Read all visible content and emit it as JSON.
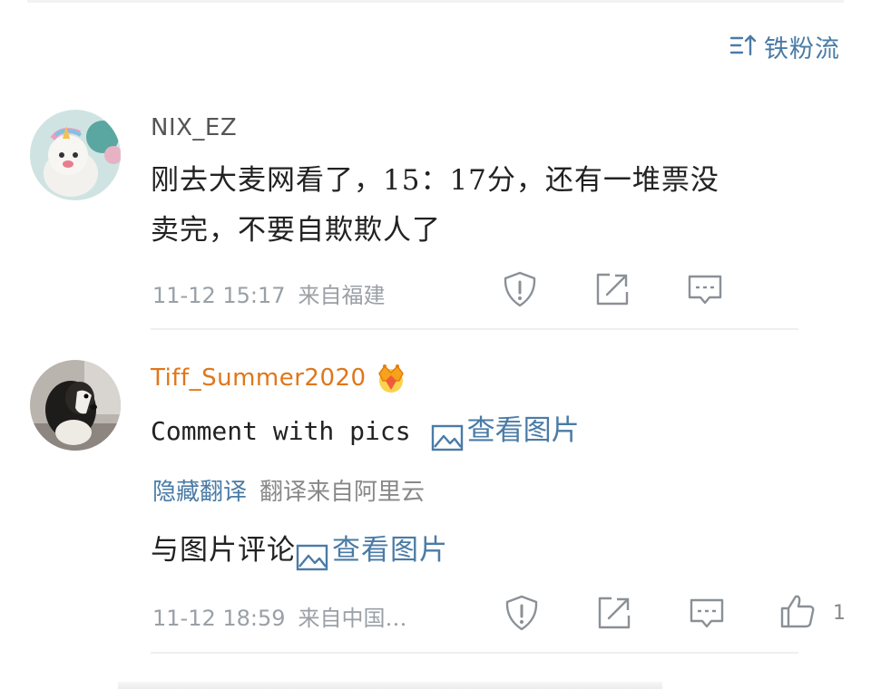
{
  "header": {
    "sort_label": "铁粉流",
    "sort_icon": "sort-icon"
  },
  "comments": [
    {
      "username": "NIX_EZ",
      "text_line1": "刚去大麦网看了，15：17分，还有一堆票没",
      "text_line2": "卖完，不要自欺欺人了",
      "time": "11-12  15:17",
      "source": "来自福建"
    },
    {
      "username": "Tiff_Summer2020",
      "badge_icon": "crown-icon",
      "text_prefix": "Comment  with  pics",
      "pic_link": "查看图片",
      "translation_hide": "隐藏翻译",
      "translation_source": "翻译来自阿里云",
      "translated_prefix": "与图片评论",
      "translated_pic_link": "查看图片",
      "time": "11-12  18:59",
      "source": "来自中国…",
      "like_count": "1"
    }
  ],
  "colors": {
    "link": "#4a7ba6",
    "vip_name": "#e0761a",
    "meta": "#9aa0a6",
    "icon": "#8a9096"
  }
}
